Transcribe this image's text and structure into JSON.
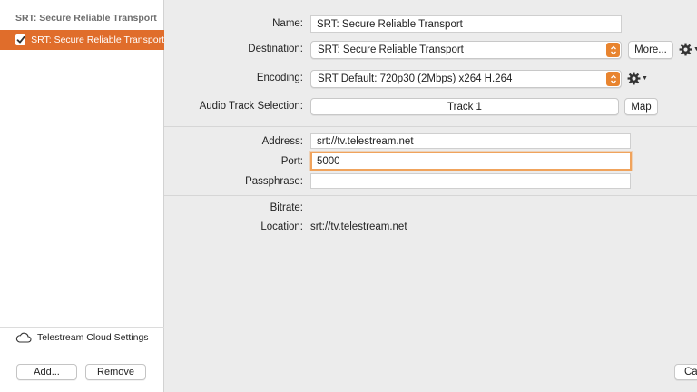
{
  "sidebar": {
    "header": "SRT: Secure Reliable Transport",
    "items": [
      {
        "label": "SRT: Secure Reliable Transport",
        "checked": true
      }
    ],
    "cloud_label": "Telestream Cloud Settings",
    "add_label": "Add...",
    "remove_label": "Remove"
  },
  "form": {
    "name_label": "Name:",
    "name_value": "SRT: Secure Reliable Transport",
    "destination_label": "Destination:",
    "destination_value": "SRT: Secure Reliable Transport",
    "more_label": "More...",
    "encoding_label": "Encoding:",
    "encoding_value": "SRT Default: 720p30 (2Mbps) x264 H.264",
    "audio_label": "Audio Track Selection:",
    "audio_value": "Track 1",
    "map_label": "Map",
    "address_label": "Address:",
    "address_value": "srt://tv.telestream.net",
    "port_label": "Port:",
    "port_value": "5000",
    "passphrase_label": "Passphrase:",
    "passphrase_value": "",
    "bitrate_label": "Bitrate:",
    "bitrate_value": "",
    "location_label": "Location:",
    "location_value": "srt://tv.telestream.net"
  },
  "footer": {
    "cancel_partial": "Ca"
  },
  "colors": {
    "accent": "#e06d2b",
    "popup_arrow": "#e8842f",
    "focus_ring": "#f0a35c"
  },
  "icons": [
    "checkbox-checked-icon",
    "cloud-icon",
    "popup-arrows-icon",
    "gear-icon"
  ]
}
